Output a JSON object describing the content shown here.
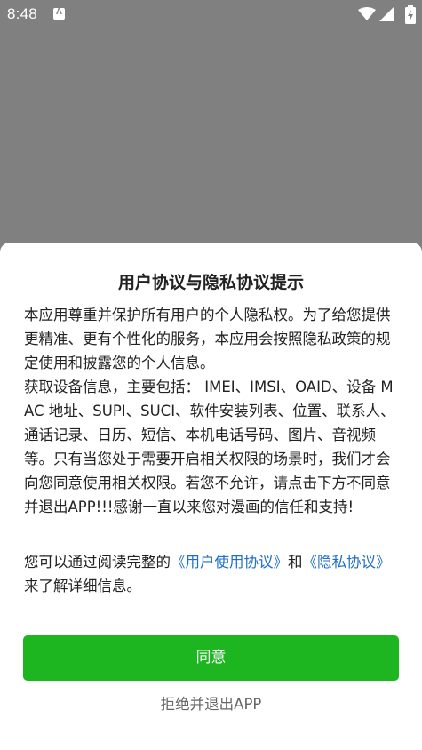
{
  "status_bar": {
    "time": "8:48",
    "notification_icon": "a-icon",
    "wifi_icon": "wifi-icon",
    "signal_icon": "signal-icon",
    "battery_icon": "battery-charging-icon",
    "a_glyph": "A"
  },
  "dialog": {
    "title": "用户协议与隐私协议提示",
    "paragraph1": "本应用尊重并保护所有用户的个人隐私权。为了给您提供更精准、更有个性化的服务，本应用会按照隐私政策的规定使用和披露您的个人信息。",
    "paragraph2": "获取设备信息，主要包括： IMEI、IMSI、OAID、设备 MAC 地址、SUPI、SUCI、软件安装列表、位置、联系人、通话记录、日历、短信、本机电话号码、图片、音视频等。只有当您处于需要开启相关权限的场景时，我们才会向您同意使用相关权限。若您不允许，请点击下方不同意并退出APP!!!感谢一直以来您对漫画的信任和支持!",
    "link_para_prefix": "您可以通过阅读完整的",
    "user_agreement_link": "《用户使用协议》",
    "link_para_and": "和",
    "privacy_link": "《隐私协议》",
    "link_para_suffix": "来了解详细信息。",
    "agree_label": "同意",
    "decline_label": "拒绝并退出APP"
  },
  "colors": {
    "overlay": "#808080",
    "accent_green": "#1db520",
    "link_blue": "#1f6fc5"
  }
}
